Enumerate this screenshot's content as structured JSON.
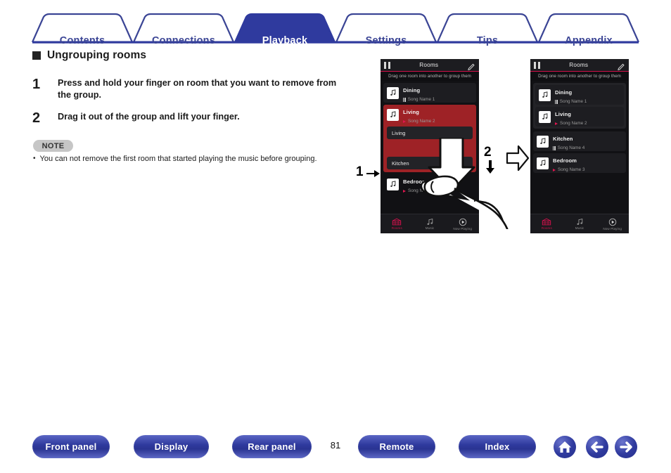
{
  "nav_tabs": [
    {
      "label": "Contents",
      "active": false
    },
    {
      "label": "Connections",
      "active": false
    },
    {
      "label": "Playback",
      "active": true
    },
    {
      "label": "Settings",
      "active": false
    },
    {
      "label": "Tips",
      "active": false
    },
    {
      "label": "Appendix",
      "active": false
    }
  ],
  "section": {
    "title": "Ungrouping rooms"
  },
  "steps": [
    {
      "number": "1",
      "text": "Press and hold your finger on room that you want to remove from the group."
    },
    {
      "number": "2",
      "text": "Drag it out of the group and lift your finger."
    }
  ],
  "note": {
    "badge": "NOTE",
    "bullet": "•",
    "text": "You can not remove the first room that started playing the music before grouping."
  },
  "annotations": {
    "step_one": "1",
    "step_two": "2"
  },
  "phone_before": {
    "header": {
      "title": "Rooms",
      "pause_icon": "pause-icon",
      "edit_icon": "pencil-icon"
    },
    "hint": "Drag one room into another to group them",
    "rooms": [
      {
        "name": "Dining",
        "song": "Song Name 1",
        "state": "pause"
      }
    ],
    "group": {
      "name": "Living",
      "song": "Song Name 2",
      "state": "play",
      "members": [
        "Living",
        "Kitchen"
      ]
    },
    "trailing_rooms": [
      {
        "name": "Bedroom",
        "song": "Song Name 3",
        "state": "play"
      }
    ],
    "bottom_nav": [
      {
        "label": "Rooms",
        "icon": "rooms-icon",
        "active": true
      },
      {
        "label": "Music",
        "icon": "music-note-icon",
        "active": false
      },
      {
        "label": "Now Playing",
        "icon": "play-circle-icon",
        "active": false
      }
    ]
  },
  "phone_after": {
    "header": {
      "title": "Rooms",
      "pause_icon": "pause-icon",
      "edit_icon": "pencil-icon"
    },
    "hint": "Drag one room into another to group them",
    "grouped": [
      {
        "name": "Dining",
        "song": "Song Name 1",
        "state": "pause"
      },
      {
        "name": "Living",
        "song": "Song Name 2",
        "state": "play"
      }
    ],
    "ungrouped": [
      {
        "name": "Kitchen",
        "song": "Song Name 4",
        "state": "pause"
      },
      {
        "name": "Bedroom",
        "song": "Song Name 3",
        "state": "play"
      }
    ],
    "bottom_nav": [
      {
        "label": "Rooms",
        "icon": "rooms-icon",
        "active": true
      },
      {
        "label": "Music",
        "icon": "music-note-icon",
        "active": false
      },
      {
        "label": "Now Playing",
        "icon": "play-circle-icon",
        "active": false
      }
    ]
  },
  "footer": {
    "buttons": [
      {
        "label": "Front panel"
      },
      {
        "label": "Display"
      },
      {
        "label": "Rear panel"
      },
      {
        "label": "Remote"
      },
      {
        "label": "Index"
      }
    ],
    "page_number": "81",
    "icons": [
      {
        "name": "home-icon"
      },
      {
        "name": "arrow-left-icon"
      },
      {
        "name": "arrow-right-icon"
      }
    ]
  },
  "colors": {
    "brand_blue": "#3b4595",
    "active_tab": "#2f3a9e",
    "group_red": "#9e2226",
    "accent_pink": "#d1104a",
    "phone_bg": "#111114"
  }
}
